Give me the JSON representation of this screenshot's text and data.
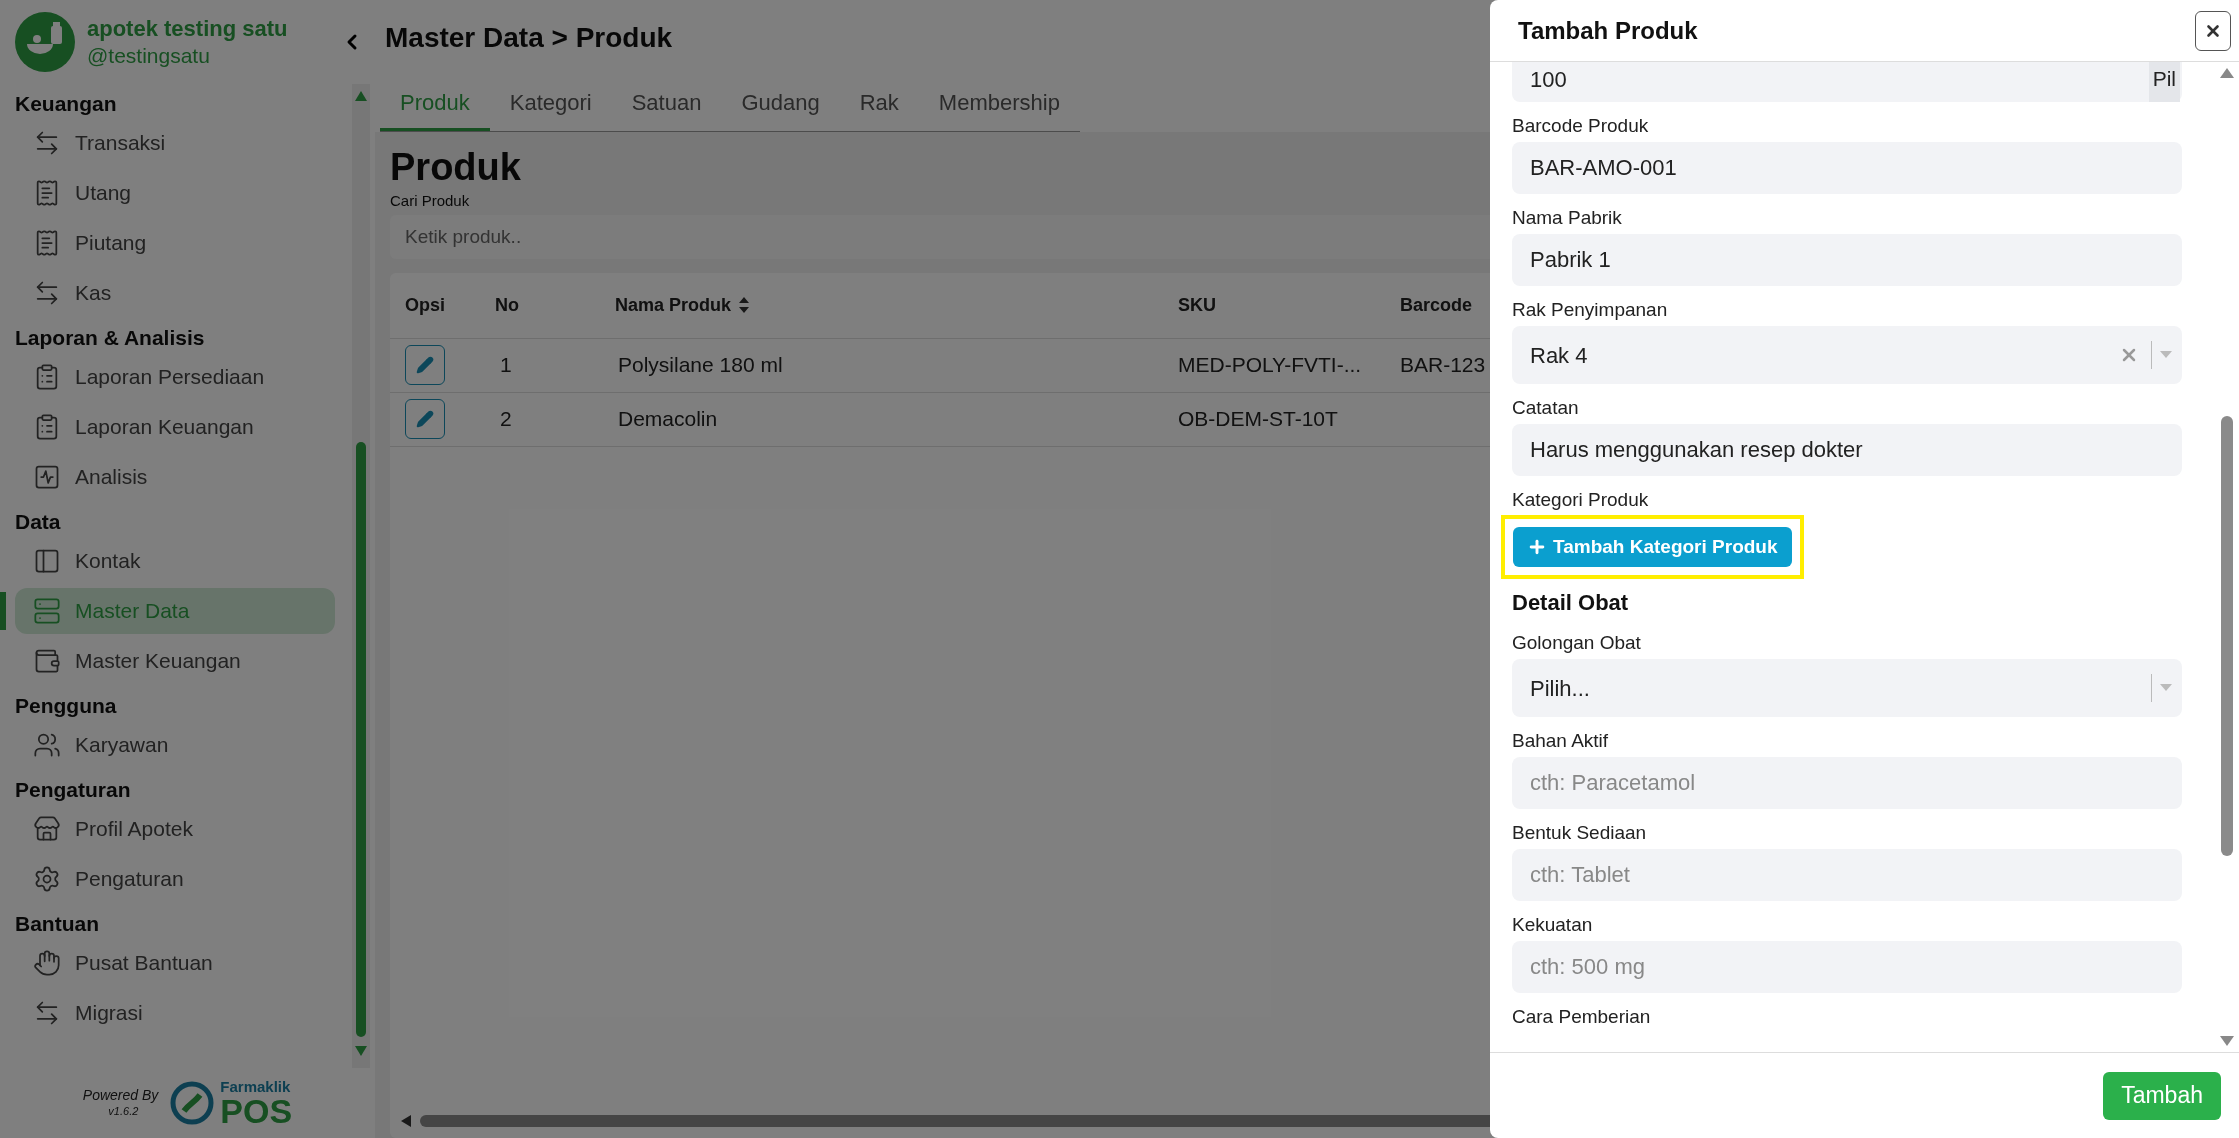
{
  "sidebar": {
    "brand_name": "apotek testing satu",
    "brand_handle": "@testingsatu",
    "sections": [
      {
        "title": "Keuangan",
        "items": [
          {
            "label": "Transaksi",
            "selected": false
          },
          {
            "label": "Utang",
            "selected": false
          },
          {
            "label": "Piutang",
            "selected": false
          },
          {
            "label": "Kas",
            "selected": false
          }
        ]
      },
      {
        "title": "Laporan & Analisis",
        "items": [
          {
            "label": "Laporan Persediaan",
            "selected": false
          },
          {
            "label": "Laporan Keuangan",
            "selected": false
          },
          {
            "label": "Analisis",
            "selected": false
          }
        ]
      },
      {
        "title": "Data",
        "items": [
          {
            "label": "Kontak",
            "selected": false
          },
          {
            "label": "Master Data",
            "selected": true
          },
          {
            "label": "Master Keuangan",
            "selected": false
          }
        ]
      },
      {
        "title": "Pengguna",
        "items": [
          {
            "label": "Karyawan",
            "selected": false
          }
        ]
      },
      {
        "title": "Pengaturan",
        "items": [
          {
            "label": "Profil Apotek",
            "selected": false
          },
          {
            "label": "Pengaturan",
            "selected": false
          }
        ]
      },
      {
        "title": "Bantuan",
        "items": [
          {
            "label": "Pusat Bantuan",
            "selected": false
          },
          {
            "label": "Migrasi",
            "selected": false
          }
        ]
      }
    ],
    "powered_by": "Powered By",
    "version": "v1.6.2",
    "logo_top": "Farmaklik",
    "logo_bottom": "POS"
  },
  "main": {
    "breadcrumb": "Master Data > Produk",
    "tabs": [
      {
        "label": "Produk",
        "selected": true
      },
      {
        "label": "Kategori",
        "selected": false
      },
      {
        "label": "Satuan",
        "selected": false
      },
      {
        "label": "Gudang",
        "selected": false
      },
      {
        "label": "Rak",
        "selected": false
      },
      {
        "label": "Membership",
        "selected": false
      }
    ],
    "page_title": "Produk",
    "search_label": "Cari Produk",
    "search_placeholder": "Ketik produk..",
    "table": {
      "columns": [
        {
          "label": "Opsi",
          "sortable": false
        },
        {
          "label": "No",
          "sortable": false
        },
        {
          "label": "Nama Produk",
          "sortable": true
        },
        {
          "label": "SKU",
          "sortable": false
        },
        {
          "label": "Barcode",
          "sortable": false
        }
      ],
      "rows": [
        {
          "no": "1",
          "name": "Polysilane 180 ml",
          "sku": "MED-POLY-FVTI-...",
          "barcode": "BAR-123"
        },
        {
          "no": "2",
          "name": "Demacolin",
          "sku": "OB-DEM-ST-10T"
        }
      ]
    }
  },
  "drawer": {
    "title": "Tambah Produk",
    "fields": [
      {
        "kind": "suffix",
        "value": "100",
        "suffix": "Pil"
      },
      {
        "kind": "text",
        "label": "Barcode Produk",
        "value": "BAR-AMO-001"
      },
      {
        "kind": "text",
        "label": "Nama Pabrik",
        "value": "Pabrik 1"
      },
      {
        "kind": "select",
        "label": "Rak Penyimpanan",
        "value": "Rak 4",
        "clearable": true
      },
      {
        "kind": "text",
        "label": "Catatan",
        "value": "Harus menggunakan resep dokter"
      },
      {
        "kind": "button",
        "label": "Kategori Produk",
        "button": "Tambah Kategori Produk",
        "highlighted": true
      },
      {
        "kind": "heading",
        "label": "Detail Obat"
      },
      {
        "kind": "select",
        "label": "Golongan Obat",
        "value": "Pilih...",
        "clearable": false
      },
      {
        "kind": "text",
        "label": "Bahan Aktif",
        "placeholder": "cth: Paracetamol"
      },
      {
        "kind": "text",
        "label": "Bentuk Sediaan",
        "placeholder": "cth: Tablet"
      },
      {
        "kind": "text",
        "label": "Kekuatan",
        "placeholder": "cth: 500 mg"
      },
      {
        "kind": "label",
        "label": "Cara Pemberian"
      }
    ],
    "submit": "Tambah"
  }
}
